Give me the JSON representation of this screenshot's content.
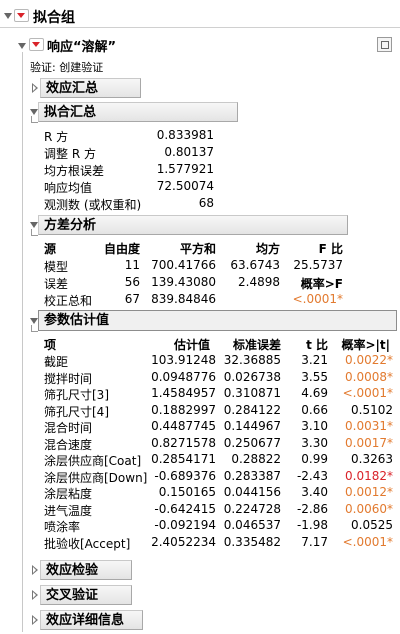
{
  "title": "拟合组",
  "response": {
    "title": "响应“溶解”",
    "validation": "验证: 创建验证"
  },
  "effect_summary": {
    "title": "效应汇总"
  },
  "fit_summary": {
    "title": "拟合汇总",
    "rows": [
      {
        "label": "R 方",
        "value": "0.833981"
      },
      {
        "label": "调整 R 方",
        "value": "0.80137"
      },
      {
        "label": "均方根误差",
        "value": "1.577921"
      },
      {
        "label": "响应均值",
        "value": "72.50074"
      },
      {
        "label": "观测数 (或权重和)",
        "value": "68"
      }
    ]
  },
  "anova": {
    "title": "方差分析",
    "headers": [
      "源",
      "自由度",
      "平方和",
      "均方",
      "F 比"
    ],
    "rows": [
      {
        "source": "模型",
        "df": "11",
        "ss": "700.41766",
        "ms": "63.6743",
        "f": "25.5737"
      },
      {
        "source": "误差",
        "df": "56",
        "ss": "139.43080",
        "ms": "2.4898",
        "f": "概率>F"
      },
      {
        "source": "校正总和",
        "df": "67",
        "ss": "839.84846",
        "ms": "",
        "f": "<.0001*"
      }
    ]
  },
  "estimates": {
    "title": "参数估计值",
    "headers": [
      "项",
      "估计值",
      "标准误差",
      "t 比",
      "概率>|t|"
    ],
    "rows": [
      {
        "term": "截距",
        "est": "103.91248",
        "se": "32.36885",
        "t": "3.21",
        "p": "0.0022*",
        "sig": true
      },
      {
        "term": "搅拌时间",
        "est": "0.0948776",
        "se": "0.026738",
        "t": "3.55",
        "p": "0.0008*",
        "sig": true
      },
      {
        "term": "筛孔尺寸[3]",
        "est": "1.4584957",
        "se": "0.310871",
        "t": "4.69",
        "p": "<.0001*",
        "sig": true
      },
      {
        "term": "筛孔尺寸[4]",
        "est": "0.1882997",
        "se": "0.284122",
        "t": "0.66",
        "p": "0.5102",
        "sig": false
      },
      {
        "term": "混合时间",
        "est": "0.4487745",
        "se": "0.144967",
        "t": "3.10",
        "p": "0.0031*",
        "sig": true
      },
      {
        "term": "混合速度",
        "est": "0.8271578",
        "se": "0.250677",
        "t": "3.30",
        "p": "0.0017*",
        "sig": true
      },
      {
        "term": "涂层供应商[Coat]",
        "est": "0.2854171",
        "se": "0.28822",
        "t": "0.99",
        "p": "0.3263",
        "sig": false
      },
      {
        "term": "涂层供应商[Down]",
        "est": "-0.689376",
        "se": "0.283387",
        "t": "-2.43",
        "p": "0.0182*",
        "sig": true,
        "red": true
      },
      {
        "term": "涂层粘度",
        "est": "0.150165",
        "se": "0.044156",
        "t": "3.40",
        "p": "0.0012*",
        "sig": true
      },
      {
        "term": "进气温度",
        "est": "-0.642415",
        "se": "0.224728",
        "t": "-2.86",
        "p": "0.0060*",
        "sig": true
      },
      {
        "term": "喷涂率",
        "est": "-0.092194",
        "se": "0.046537",
        "t": "-1.98",
        "p": "0.0525",
        "sig": false
      },
      {
        "term": "批验收[Accept]",
        "est": "2.4052234",
        "se": "0.335482",
        "t": "7.17",
        "p": "<.0001*",
        "sig": true
      }
    ]
  },
  "bottom_sections": [
    "效应检验",
    "交叉验证",
    "效应详细信息"
  ],
  "colors": {
    "significant": "#e27a2f",
    "strong": "#d9232a"
  }
}
